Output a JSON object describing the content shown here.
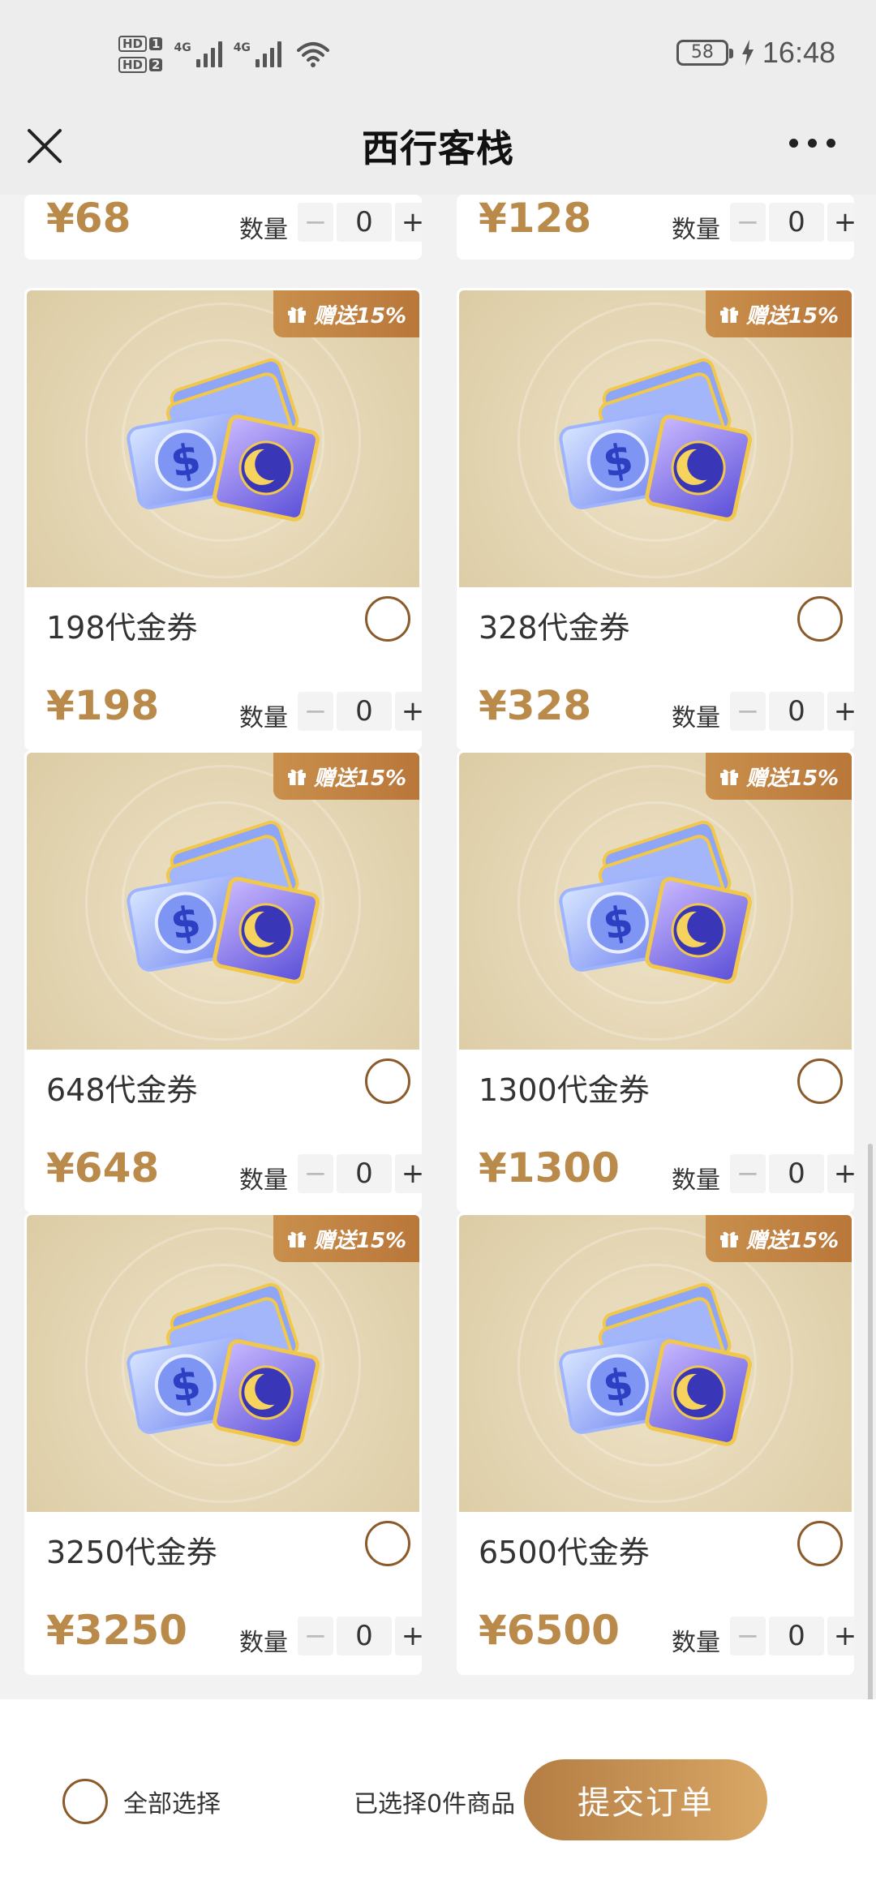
{
  "status_bar": {
    "hd1": "HD",
    "hd1_num": "1",
    "hd2": "HD",
    "hd2_num": "2",
    "net1": "4G",
    "net2": "4G",
    "battery": "58",
    "time": "16:48"
  },
  "nav": {
    "title": "西行客栈",
    "close_icon": "close-icon",
    "more_icon": "more-icon"
  },
  "quantity_label": "数量",
  "badge_text": "赠送15%",
  "top_partial": [
    {
      "price": "¥68",
      "qty": "0"
    },
    {
      "price": "¥128",
      "qty": "0"
    }
  ],
  "products": [
    {
      "name": "198代金券",
      "price": "¥198",
      "qty": "0"
    },
    {
      "name": "328代金券",
      "price": "¥328",
      "qty": "0"
    },
    {
      "name": "648代金券",
      "price": "¥648",
      "qty": "0"
    },
    {
      "name": "1300代金券",
      "price": "¥1300",
      "qty": "0"
    },
    {
      "name": "3250代金券",
      "price": "¥3250",
      "qty": "0"
    },
    {
      "name": "6500代金券",
      "price": "¥6500",
      "qty": "0"
    }
  ],
  "stepper": {
    "minus": "−",
    "plus": "+"
  },
  "bottom": {
    "select_all": "全部选择",
    "selected_text": "已选择0件商品",
    "submit": "提交订单"
  },
  "colors": {
    "accent": "#b98a4a",
    "badge": "#c98f4c",
    "submit_start": "#b47d43",
    "submit_end": "#d9a766"
  }
}
